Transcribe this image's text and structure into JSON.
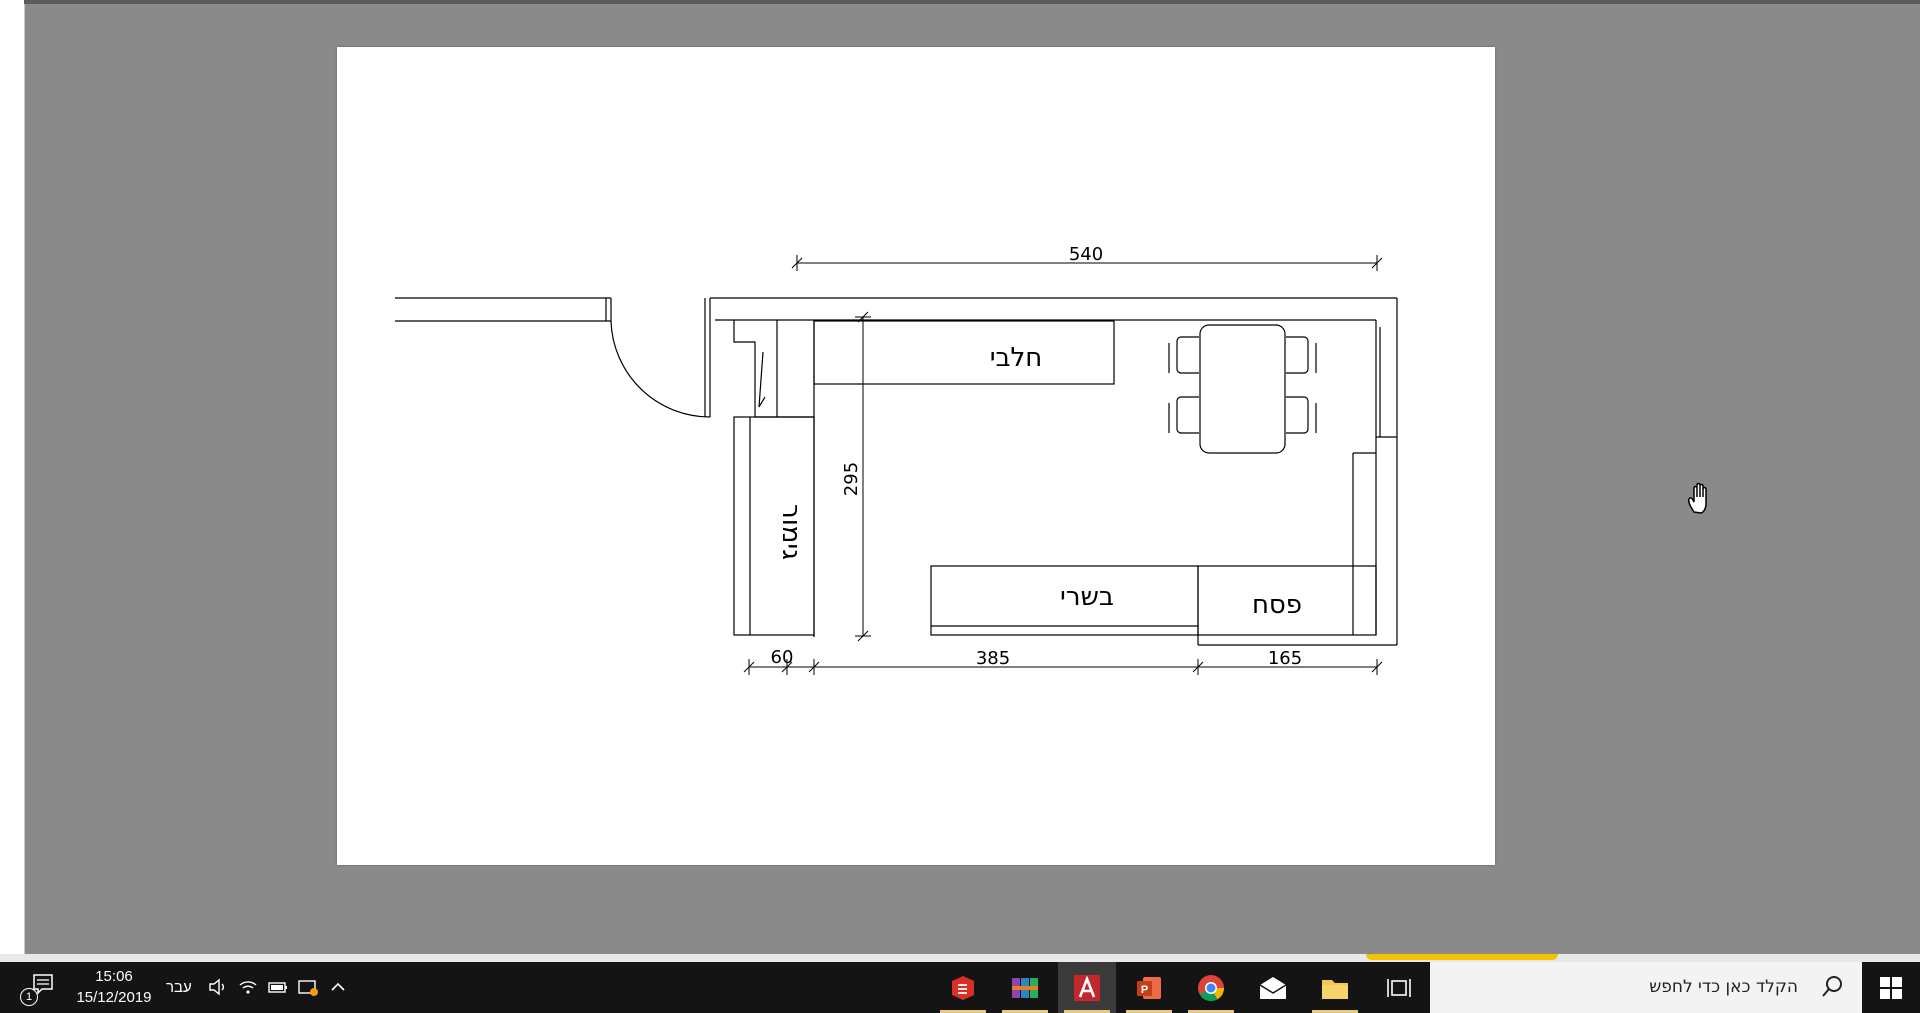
{
  "drawing": {
    "dimensions": {
      "top_width": "540",
      "height": "295",
      "bottom_left": "60",
      "bottom_middle": "385",
      "bottom_right": "165"
    },
    "labels": {
      "dairy": "חלבי",
      "meat": "בשרי",
      "passover": "פסח",
      "finishing": "גימור"
    }
  },
  "taskbar": {
    "search_placeholder": "הקלד כאן כדי לחפש",
    "clock_time": "15:06",
    "clock_date": "15/12/2019",
    "language": "עבר",
    "notification_count": "1",
    "apps": [
      {
        "name": "sketchup"
      },
      {
        "name": "winrar"
      },
      {
        "name": "autocad",
        "active": true
      },
      {
        "name": "powerpoint"
      },
      {
        "name": "chrome"
      },
      {
        "name": "mail"
      },
      {
        "name": "file-explorer"
      },
      {
        "name": "task-view"
      }
    ]
  },
  "colors": {
    "workspace": "#8a8a8a",
    "taskbar": "#141414",
    "paper": "#ffffff",
    "accent_yellow": "#f5c000"
  }
}
